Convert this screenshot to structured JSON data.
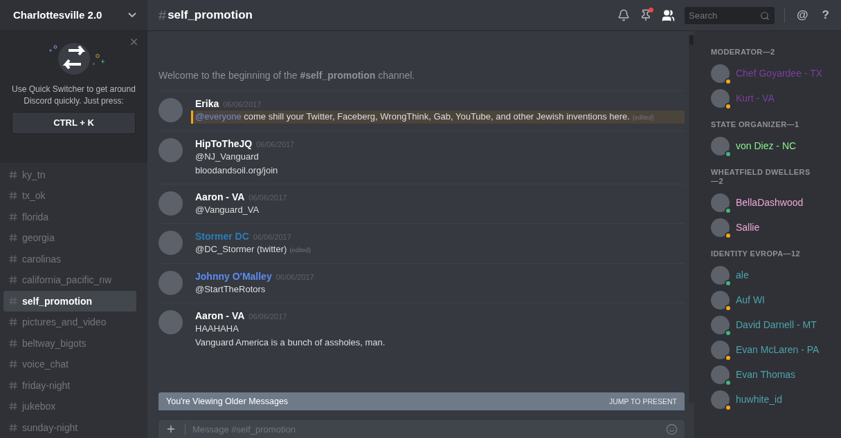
{
  "server": {
    "name": "Charlottesville 2.0"
  },
  "quick_switcher": {
    "text": "Use Quick Switcher to get around Discord quickly. Just press:",
    "shortcut": "CTRL + K"
  },
  "channels": [
    {
      "name": "ky_tn",
      "selected": false
    },
    {
      "name": "tx_ok",
      "selected": false
    },
    {
      "name": "florida",
      "selected": false
    },
    {
      "name": "georgia",
      "selected": false
    },
    {
      "name": "carolinas",
      "selected": false
    },
    {
      "name": "california_pacific_nw",
      "selected": false
    },
    {
      "name": "self_promotion",
      "selected": true
    },
    {
      "name": "pictures_and_video",
      "selected": false
    },
    {
      "name": "beltway_bigots",
      "selected": false
    },
    {
      "name": "voice_chat",
      "selected": false
    },
    {
      "name": "friday-night",
      "selected": false
    },
    {
      "name": "jukebox",
      "selected": false
    },
    {
      "name": "sunday-night",
      "selected": false
    }
  ],
  "header": {
    "hash": "#",
    "channel": "self_promotion",
    "search_placeholder": "Search",
    "pins_unread": true,
    "at": "@",
    "help": "?"
  },
  "welcome": "Welcome to the beginning of the **#self_promotion** channel.",
  "messages": [
    {
      "author": "Erika",
      "color": "#ffffff",
      "date": "06/06/2017",
      "mentioned": true,
      "mention": "@everyone",
      "lines": [
        "come shill your Twitter, Faceberg, WrongThink, Gab, YouTube, and other Jewish inventions here."
      ],
      "edited": "(edited)"
    },
    {
      "author": "HipToTheJQ",
      "color": "#ffffff",
      "date": "06/06/2017",
      "mentioned": false,
      "lines": [
        "@NJ_Vanguard",
        "bloodandsoil.org/join"
      ]
    },
    {
      "author": "Aaron - VA",
      "color": "#ffffff",
      "date": "06/06/2017",
      "mentioned": false,
      "lines": [
        "@Vanguard_VA"
      ]
    },
    {
      "author": "Stormer DC",
      "color": "#2e7db8",
      "date": "06/06/2017",
      "mentioned": false,
      "lines": [
        "@DC_Stormer (twitter)"
      ],
      "edited": "(edited)"
    },
    {
      "author": "Johnny O'Malley",
      "color": "#5b8cf0",
      "date": "06/06/2017",
      "mentioned": false,
      "lines": [
        "@StartTheRotors"
      ]
    },
    {
      "author": "Aaron - VA",
      "color": "#ffffff",
      "date": "06/06/2017",
      "mentioned": false,
      "lines": [
        "HAAHAHA",
        "Vanguard America is a bunch of assholes, man."
      ]
    }
  ],
  "older_banner": {
    "text": "You're Viewing Older Messages",
    "action": "JUMP TO PRESENT"
  },
  "composer": {
    "placeholder": "Message #self_promotion"
  },
  "member_groups": [
    {
      "title": "MODERATOR—2",
      "members": [
        {
          "name": "Chef Goyardee - TX",
          "color": "#7b3fa0",
          "idle": true
        },
        {
          "name": "Kurt - VA",
          "color": "#7b3fa0",
          "idle": true
        }
      ]
    },
    {
      "title": "STATE ORGANIZER—1",
      "members": [
        {
          "name": "von Diez - NC",
          "color": "#8cf08c",
          "idle": false
        }
      ]
    },
    {
      "title": "WHEATFIELD DWELLERS—2",
      "members": [
        {
          "name": "BellaDashwood",
          "color": "#f0a8d8",
          "idle": false
        },
        {
          "name": "Sallie",
          "color": "#f0a8d8",
          "idle": true
        }
      ]
    },
    {
      "title": "IDENTITY EVROPA—12",
      "members": [
        {
          "name": "ale",
          "color": "#4fa3ad",
          "idle": false
        },
        {
          "name": "Auf WI",
          "color": "#4fa3ad",
          "idle": true
        },
        {
          "name": "David Darnell - MT",
          "color": "#4fa3ad",
          "idle": false
        },
        {
          "name": "Evan McLaren - PA",
          "color": "#4fa3ad",
          "idle": true
        },
        {
          "name": "Evan Thomas",
          "color": "#4fa3ad",
          "idle": false
        },
        {
          "name": "huwhite_id",
          "color": "#4fa3ad",
          "idle": true
        }
      ]
    }
  ]
}
